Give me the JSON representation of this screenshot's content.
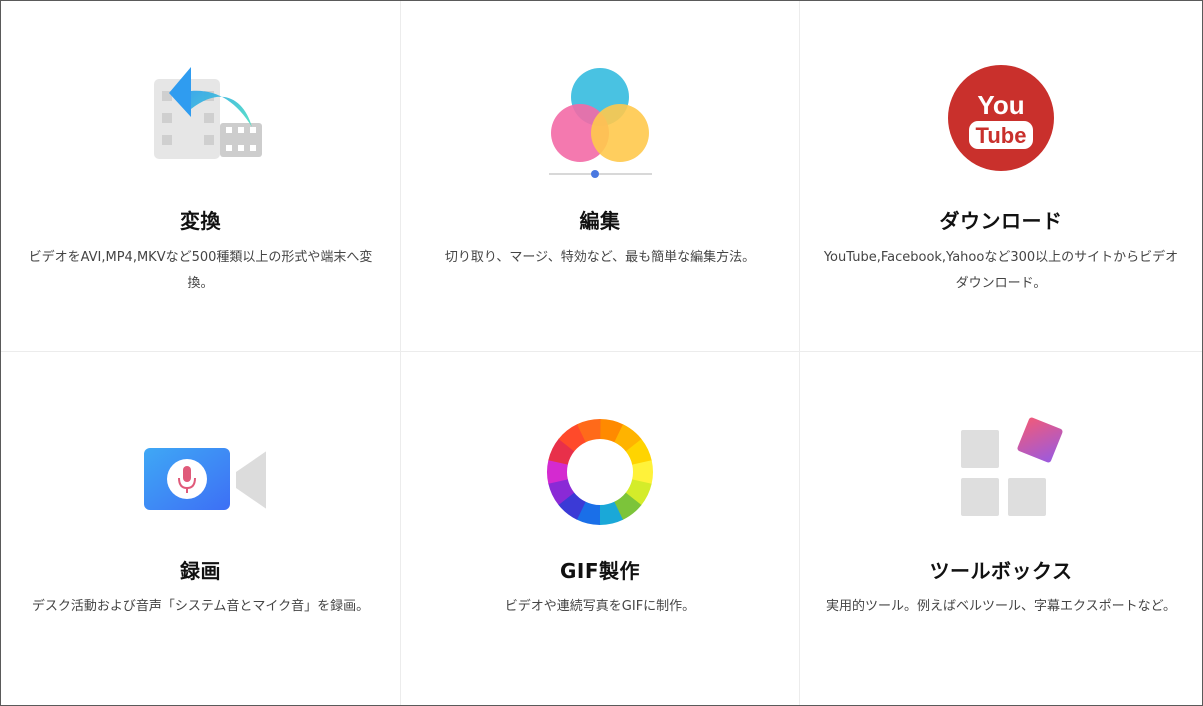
{
  "features": [
    {
      "id": "convert",
      "icon": "video-convert-icon",
      "title": "変換",
      "description": "ビデオをAVI,MP4,MKVなど500種類以上の形式や端末へ変換。"
    },
    {
      "id": "edit",
      "icon": "color-circles-edit-icon",
      "title": "編集",
      "description": "切り取り、マージ、特効など、最も簡単な編集方法。"
    },
    {
      "id": "download",
      "icon": "youtube-download-icon",
      "title": "ダウンロード",
      "description": "YouTube,Facebook,Yahooなど300以上のサイトからビデオダウンロード。"
    },
    {
      "id": "record",
      "icon": "screen-record-camera-icon",
      "title": "録画",
      "description": "デスク活動および音声「システム音とマイク音」を録画。"
    },
    {
      "id": "gif",
      "icon": "color-wheel-gif-icon",
      "title": "GIF製作",
      "description": "ビデオや連続写真をGIFに制作。"
    },
    {
      "id": "toolbox",
      "icon": "toolbox-grid-icon",
      "title": "ツールボックス",
      "description": "実用的ツール。例えばベルツール、字幕エクスポートなど。"
    }
  ],
  "youtube_logo": {
    "you": "You",
    "tube": "Tube"
  },
  "colors": {
    "youtube_red": "#c9302c",
    "record_blue": "#3d7ff5",
    "mic_pink": "#e05a7a",
    "circle_blue": "#3fbfe0",
    "circle_pink": "#f36aa6",
    "circle_yellow": "#ffc94d",
    "toolbox_gray": "#dedede",
    "toolbox_accent": "#c85bd0"
  }
}
